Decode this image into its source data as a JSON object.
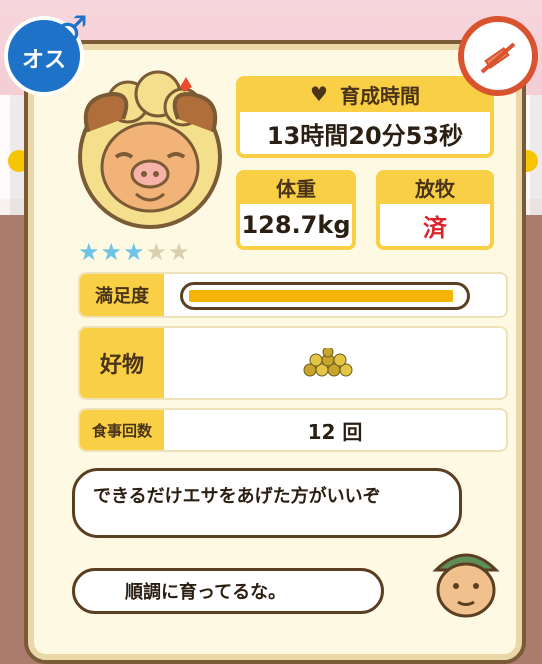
{
  "gender_badge": {
    "label": "オス",
    "icon": "male-symbol-icon",
    "color": "#1e73c8"
  },
  "medicine_badge": {
    "icon": "syringe-icon",
    "color": "#d9532f"
  },
  "rating": {
    "stars_filled": 3,
    "stars_total": 5
  },
  "stats": {
    "growth_time_label": "育成時間",
    "growth_time_value": "13時間20分53秒",
    "weight_label": "体重",
    "weight_value": "128.7kg",
    "grazing_label": "放牧",
    "grazing_value": "済"
  },
  "satisfaction": {
    "label": "満足度",
    "level": 0.98
  },
  "favorite": {
    "label": "好物",
    "item_icon": "grain-pile-icon"
  },
  "meals": {
    "label": "食事回数",
    "value": "12 回"
  },
  "dialogue": {
    "line1": "できるだけエサをあげた方がいいぞ",
    "line2": "順調に育ってるな。"
  }
}
